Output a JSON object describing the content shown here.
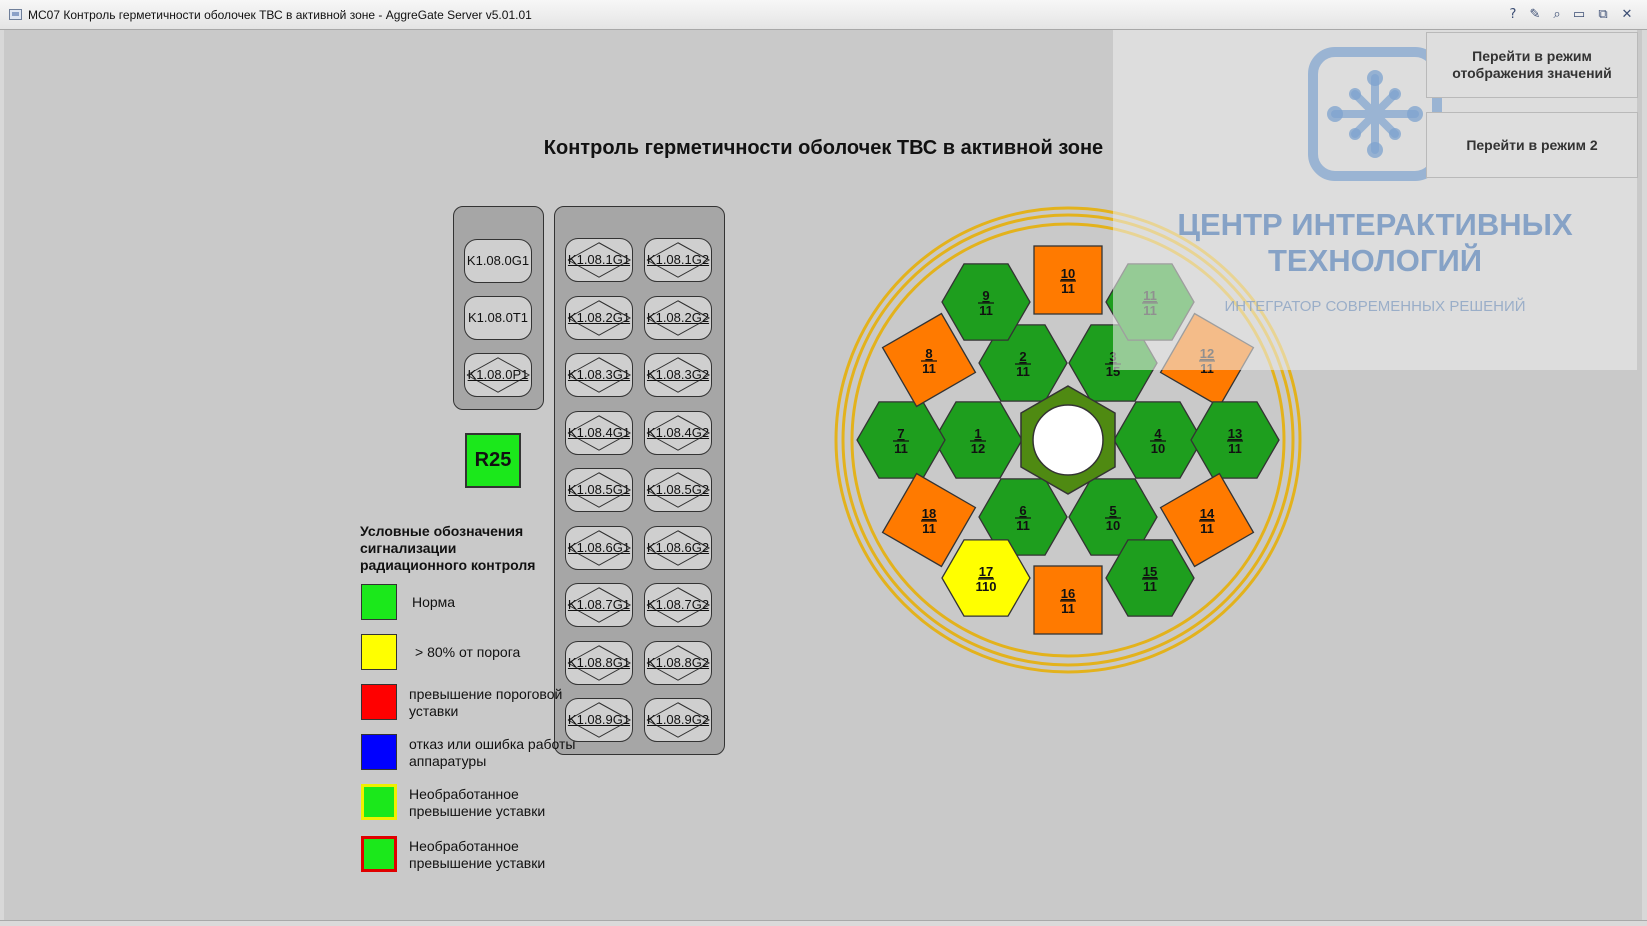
{
  "window": {
    "title": "MC07 Контроль герметичности оболочек ТВС в активной зоне - AggreGate Server v5.01.01",
    "buttons": [
      {
        "name": "help-icon",
        "glyph": "?"
      },
      {
        "name": "edit-icon",
        "glyph": "✎"
      },
      {
        "name": "search-icon",
        "glyph": "⌕"
      },
      {
        "name": "maximize-icon",
        "glyph": "▭"
      },
      {
        "name": "restore-icon",
        "glyph": "⧉"
      },
      {
        "name": "close-icon",
        "glyph": "✕"
      }
    ]
  },
  "page": {
    "title": "Контроль герметичности оболочек ТВС в активной зоне"
  },
  "sensors_left": [
    "K1.08.0G1",
    "K1.08.0T1",
    "K1.08.0P1"
  ],
  "sensors_grid": [
    [
      "K1.08.1G1",
      "K1.08.1G2"
    ],
    [
      "K1.08.2G1",
      "K1.08.2G2"
    ],
    [
      "K1.08.3G1",
      "K1.08.3G2"
    ],
    [
      "K1.08.4G1",
      "K1.08.4G2"
    ],
    [
      "K1.08.5G1",
      "K1.08.5G2"
    ],
    [
      "K1.08.6G1",
      "K1.08.6G2"
    ],
    [
      "K1.08.7G1",
      "K1.08.7G2"
    ],
    [
      "K1.08.8G1",
      "K1.08.8G2"
    ],
    [
      "K1.08.9G1",
      "K1.08.9G2"
    ]
  ],
  "r25": {
    "label": "R25",
    "color": "#1be81b"
  },
  "legend": {
    "title": "Условные обозначения сигнализации радиационного контроля",
    "items": [
      {
        "text": "Норма",
        "fill": "#1be81b",
        "border": "#333333"
      },
      {
        "text": "> 80% от порога",
        "fill": "#ffff00",
        "border": "#333333"
      },
      {
        "text": "превышение пороговой уставки",
        "fill": "#ff0000",
        "border": "#333333"
      },
      {
        "text": "отказ или ошибка работы аппаратуры",
        "fill": "#0000ff",
        "border": "#333333"
      },
      {
        "text": "Необработанное превышение уставки",
        "fill": "#1be81b",
        "border": "#f0f000"
      },
      {
        "text": "Необработанное превышение уставки",
        "fill": "#1be81b",
        "border": "#e00000"
      }
    ]
  },
  "side_buttons": [
    {
      "label": "Перейти в режим отображения значений"
    },
    {
      "label": "Перейти в режим 2"
    }
  ],
  "watermark": {
    "title": "ЦЕНТР ИНТЕРАКТИВНЫХ ТЕХНОЛОГИЙ",
    "subtitle": "ИНТЕГРАТОР СОВРЕМЕННЫХ РЕШЕНИЙ"
  },
  "colors": {
    "green": "#1e9e1e",
    "orange": "#ff7a00",
    "yellow": "#ffff00",
    "core": "#4f8a12",
    "ring": "#e3b21c"
  },
  "assemblies": [
    {
      "id": "1",
      "value": "12",
      "status": "green"
    },
    {
      "id": "2",
      "value": "11",
      "status": "green"
    },
    {
      "id": "3",
      "value": "15",
      "status": "green"
    },
    {
      "id": "4",
      "value": "10",
      "status": "green"
    },
    {
      "id": "5",
      "value": "10",
      "status": "green"
    },
    {
      "id": "6",
      "value": "11",
      "status": "green"
    },
    {
      "id": "7",
      "value": "11",
      "status": "green"
    },
    {
      "id": "8",
      "value": "11",
      "status": "orange"
    },
    {
      "id": "9",
      "value": "11",
      "status": "green"
    },
    {
      "id": "10",
      "value": "11",
      "status": "orange"
    },
    {
      "id": "11",
      "value": "11",
      "status": "green"
    },
    {
      "id": "12",
      "value": "11",
      "status": "orange"
    },
    {
      "id": "13",
      "value": "11",
      "status": "green"
    },
    {
      "id": "14",
      "value": "11",
      "status": "orange"
    },
    {
      "id": "15",
      "value": "11",
      "status": "green"
    },
    {
      "id": "16",
      "value": "11",
      "status": "orange"
    },
    {
      "id": "17",
      "value": "110",
      "status": "yellow"
    },
    {
      "id": "18",
      "value": "11",
      "status": "orange"
    }
  ]
}
